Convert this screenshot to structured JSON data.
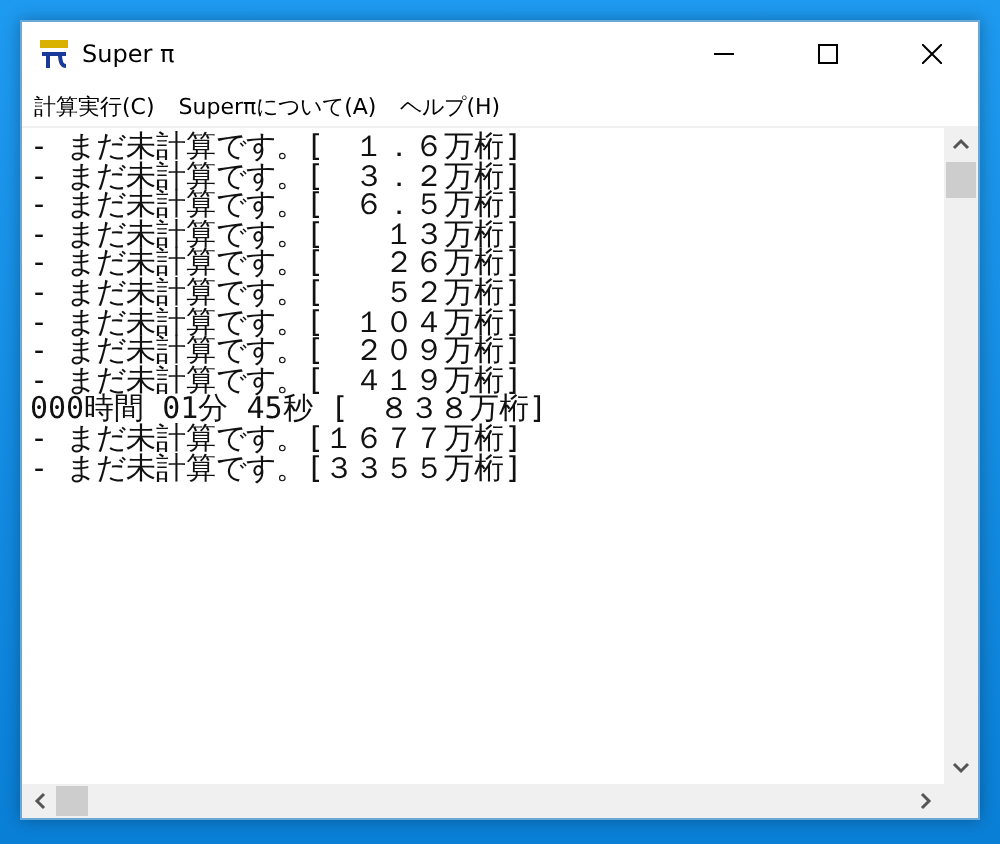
{
  "window": {
    "title": "Super π"
  },
  "menu": [
    "計算実行(C)",
    "Superπについて(A)",
    "ヘルプ(H)"
  ],
  "lines": [
    "- まだ未計算です。[　１．６万桁]",
    "- まだ未計算です。[　３．２万桁]",
    "- まだ未計算です。[　６．５万桁]",
    "- まだ未計算です。[　　１３万桁]",
    "- まだ未計算です。[　　２６万桁]",
    "- まだ未計算です。[　　５２万桁]",
    "- まだ未計算です。[　１０４万桁]",
    "- まだ未計算です。[　２０９万桁]",
    "- まだ未計算です。[　４１９万桁]",
    "000時間 01分 45秒 [　８３８万桁]",
    "- まだ未計算です。[１６７７万桁]",
    "- まだ未計算です。[３３５５万桁]"
  ]
}
